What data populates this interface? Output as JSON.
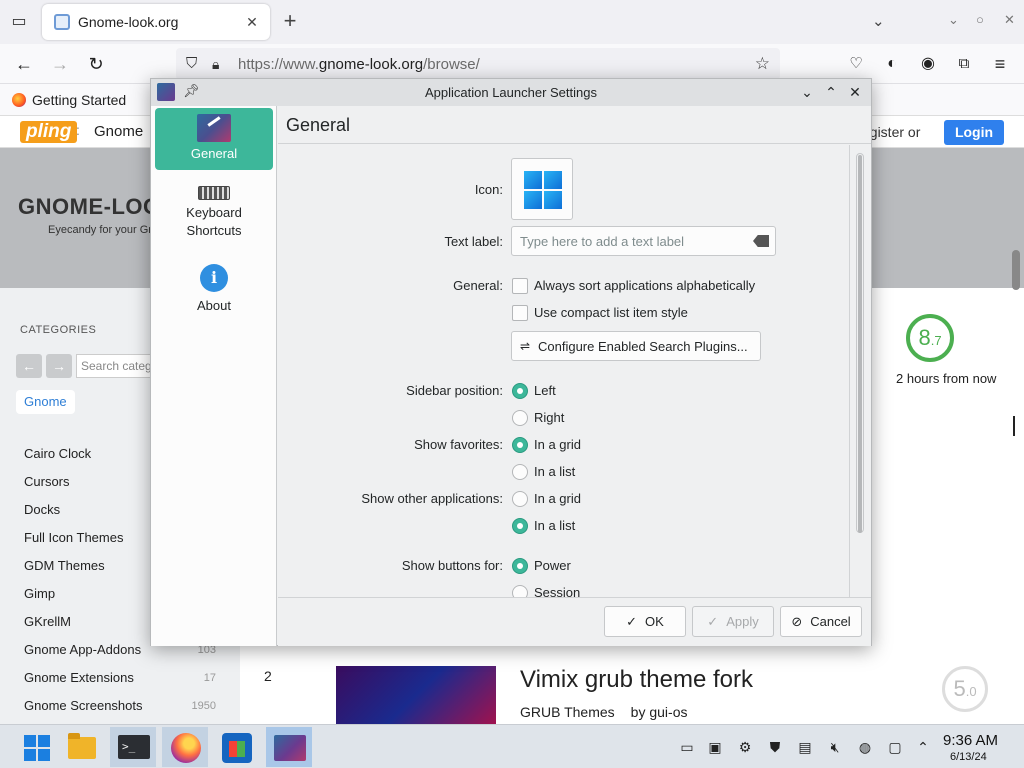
{
  "browser": {
    "tab_title": "Gnome-look.org",
    "url_prefix": "https://www.",
    "url_domain": "gnome-look.org",
    "url_path": "/browse/",
    "bookmark": "Getting Started"
  },
  "site": {
    "logo": "pling",
    "section": "Gnome",
    "register_text": "egister",
    "or_text": "or",
    "login_label": "Login",
    "banner_logo": "GNOME-LOO",
    "banner_tagline": "Eyecandy for your Gnor",
    "categories_heading": "CATEGORIES",
    "search_placeholder": "Search categ",
    "active_chip": "Gnome",
    "categories": [
      {
        "label": "Cairo Clock",
        "count": ""
      },
      {
        "label": "Cursors",
        "count": ""
      },
      {
        "label": "Docks",
        "count": ""
      },
      {
        "label": "Full Icon Themes",
        "count": ""
      },
      {
        "label": "GDM Themes",
        "count": ""
      },
      {
        "label": "Gimp",
        "count": ""
      },
      {
        "label": "GKrellM",
        "count": ""
      },
      {
        "label": "Gnome App-Addons",
        "count": "103"
      },
      {
        "label": "Gnome Extensions",
        "count": "17"
      },
      {
        "label": "Gnome Screenshots",
        "count": "1950"
      }
    ],
    "rating_main": "8",
    "rating_decimal": ".7",
    "time_text": "2 hours from now",
    "entry_number": "2",
    "entry_title": "Vimix grub theme fork",
    "entry_category": "GRUB Themes",
    "entry_author": "by gui-os",
    "entry_rating_main": "5",
    "entry_rating_decimal": ".0"
  },
  "dialog": {
    "title": "Application Launcher Settings",
    "sidebar": [
      {
        "label": "General"
      },
      {
        "label": "Keyboard Shortcuts"
      },
      {
        "label": "About"
      }
    ],
    "page_title": "General",
    "icon_label": "Icon:",
    "text_label": "Text label:",
    "text_placeholder": "Type here to add a text label",
    "general_label": "General:",
    "always_sort": "Always sort applications alphabetically",
    "compact_style": "Use compact list item style",
    "configure_plugins": "Configure Enabled Search Plugins...",
    "sidebar_position_label": "Sidebar position:",
    "sidebar_left": "Left",
    "sidebar_right": "Right",
    "show_favorites_label": "Show favorites:",
    "fav_grid": "In a grid",
    "fav_list": "In a list",
    "show_other_label": "Show other applications:",
    "other_grid": "In a grid",
    "other_list": "In a list",
    "show_buttons_label": "Show buttons for:",
    "btn_power": "Power",
    "btn_session": "Session",
    "ok_label": "OK",
    "apply_label": "Apply",
    "cancel_label": "Cancel"
  },
  "taskbar": {
    "time": "9:36 AM",
    "date": "6/13/24"
  },
  "colors": {
    "accent": "#3db79a",
    "login": "#2f80ed",
    "rating": "#4caf50"
  }
}
